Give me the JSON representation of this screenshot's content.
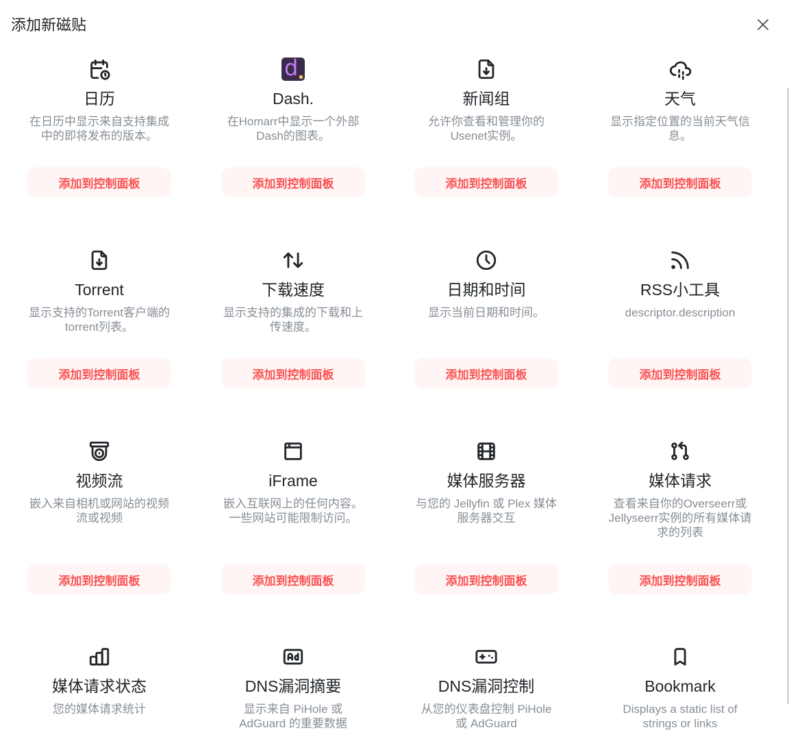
{
  "modal": {
    "title": "添加新磁贴"
  },
  "add_label": "添加到控制面板",
  "tiles": [
    {
      "name": "日历",
      "description": "在日历中显示来自支持集成中的即将发布的版本。",
      "icon": "calendar-clock-icon"
    },
    {
      "name": "Dash.",
      "description": "在Homarr中显示一个外部Dash的图表。",
      "icon": "dash-logo-icon"
    },
    {
      "name": "新闻组",
      "description": "允许你查看和管理你的Usenet实例。",
      "icon": "file-download-icon"
    },
    {
      "name": "天气",
      "description": "显示指定位置的当前天气信息。",
      "icon": "cloud-rain-icon"
    },
    {
      "name": "Torrent",
      "description": "显示支持的Torrent客户端的torrent列表。",
      "icon": "file-download-icon"
    },
    {
      "name": "下载速度",
      "description": "显示支持的集成的下载和上传速度。",
      "icon": "arrows-sort-icon"
    },
    {
      "name": "日期和时间",
      "description": "显示当前日期和时间。",
      "icon": "clock-icon"
    },
    {
      "name": "RSS小工具",
      "description": "descriptor.description",
      "icon": "rss-icon"
    },
    {
      "name": "视频流",
      "description": "嵌入来自相机或网站的视频流或视频",
      "icon": "device-cctv-icon"
    },
    {
      "name": "iFrame",
      "description": "嵌入互联网上的任何内容。一些网站可能限制访问。",
      "icon": "browser-icon"
    },
    {
      "name": "媒体服务器",
      "description": "与您的 Jellyfin 或 Plex 媒体服务器交互",
      "icon": "movie-icon"
    },
    {
      "name": "媒体请求",
      "description": "查看来自你的Overseerr或Jellyseerr实例的所有媒体请求的列表",
      "icon": "git-pull-request-icon"
    },
    {
      "name": "媒体请求状态",
      "description": "您的媒体请求统计",
      "icon": "chart-bar-icon"
    },
    {
      "name": "DNS漏洞摘要",
      "description": "显示来自 PiHole 或 AdGuard 的重要数据",
      "icon": "ad-icon"
    },
    {
      "name": "DNS漏洞控制",
      "description": "从您的仪表盘控制 PiHole 或 AdGuard",
      "icon": "device-gamepad-icon"
    },
    {
      "name": "Bookmark",
      "description": "Displays a static list of strings or links",
      "icon": "bookmark-icon"
    }
  ]
}
